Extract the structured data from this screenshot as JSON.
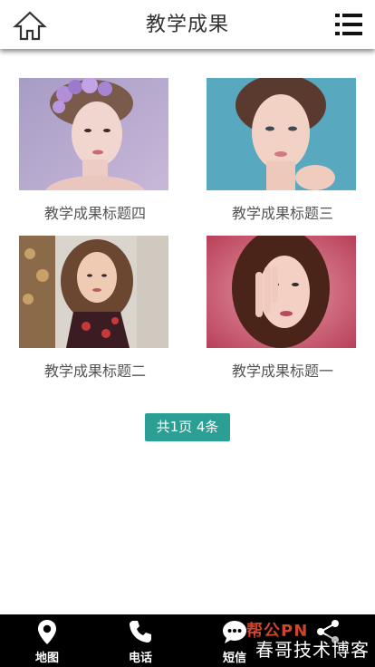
{
  "header": {
    "title": "教学成果",
    "home_icon": "home-icon",
    "menu_icon": "menu-icon"
  },
  "items": [
    {
      "caption": "教学成果标题四",
      "image": "portrait-flowers-purple"
    },
    {
      "caption": "教学成果标题三",
      "image": "portrait-teal-background"
    },
    {
      "caption": "教学成果标题二",
      "image": "portrait-giraffe-floral"
    },
    {
      "caption": "教学成果标题一",
      "image": "portrait-pink-glitter"
    }
  ],
  "pagination": {
    "text": "共1页 4条"
  },
  "bottom_nav": [
    {
      "label": "地图",
      "icon": "map-pin-icon"
    },
    {
      "label": "电话",
      "icon": "phone-icon"
    },
    {
      "label": "短信",
      "icon": "sms-icon"
    },
    {
      "label": "",
      "icon": "share-icon"
    }
  ],
  "watermark": {
    "top": "帮公PN",
    "bottom": "春哥技术博客"
  },
  "colors": {
    "accent": "#2b9f93",
    "nav_bg": "#000000",
    "text": "#555555"
  }
}
